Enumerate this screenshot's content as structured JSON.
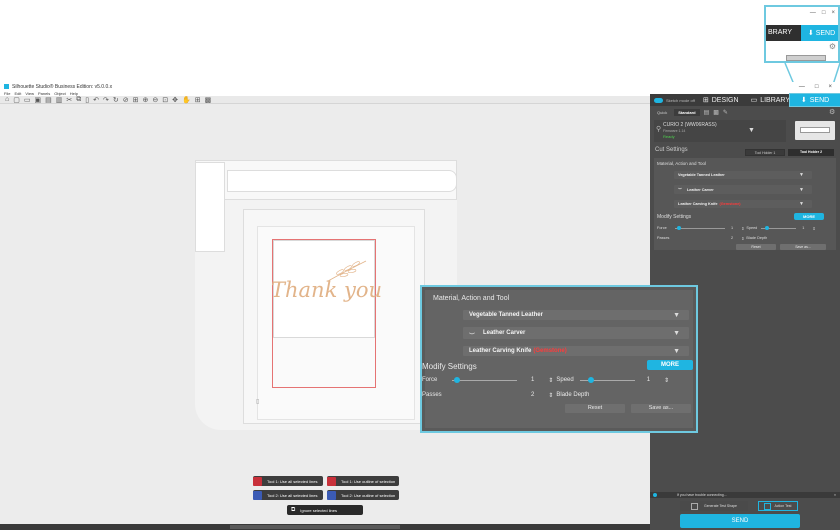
{
  "app": {
    "title": "Silhouette Studio® Business Edition: v5.0.0.x",
    "menu": [
      "File",
      "Edit",
      "View",
      "Panels",
      "Object",
      "Help"
    ],
    "window_controls": [
      "—",
      "□",
      "×"
    ]
  },
  "zoom_top": {
    "window_controls": [
      "—",
      "□",
      "×"
    ],
    "library_label": "BRARY",
    "send_label": "SEND"
  },
  "header": {
    "sketch_mode": "Sketch mode off",
    "tabs": [
      {
        "label": "DESIGN"
      },
      {
        "label": "LIBRARY"
      },
      {
        "label": "SEND",
        "active": true
      }
    ]
  },
  "send_panel": {
    "mode_tabs": [
      "Quick",
      "Standard"
    ],
    "device_name": "CURIO 2 (WW06RASS)",
    "device_sub": "Firmware 1.14",
    "device_status": "Ready",
    "cut_settings_label": "Cut Settings",
    "tool_holders": [
      "Tool Holder 1",
      "Tool Holder 2"
    ],
    "material_section": "Material, Action and Tool",
    "material": "Vegetable Tanned Leather",
    "action": "Leather Carver",
    "tool": "Leather Carving Knife",
    "tool_suffix": "(Gemstone)",
    "modify_label": "Modify Settings",
    "more_label": "MORE",
    "force_label": "Force",
    "force_value": "1",
    "speed_label": "Speed",
    "speed_value": "1",
    "passes_label": "Passes",
    "passes_value": "2",
    "blade_label": "Blade Depth",
    "reset_label": "Reset",
    "save_label": "Save as...",
    "alert_text": "If you have trouble connecting...",
    "test_cut_label": "Generate Test Shape",
    "alt_btn_label": "Action Test",
    "send_button": "SEND"
  },
  "zoom_box": {
    "section": "Material, Action and Tool",
    "material": "Vegetable Tanned Leather",
    "action": "Leather Carver",
    "tool": "Leather Carving Knife",
    "tool_suffix": "(Gemstone)",
    "modify_label": "Modify Settings",
    "more_label": "MORE",
    "force_label": "Force",
    "force_value": "1",
    "speed_label": "Speed",
    "speed_value": "1",
    "passes_label": "Passes",
    "passes_value": "2",
    "blade_label": "Blade Depth",
    "reset_label": "Reset",
    "save_label": "Save as..."
  },
  "design": {
    "text": "Thank you",
    "text_color": "#e2b48a"
  },
  "bottom_bar": {
    "tool1_all": "Tool 1: Use all selected lines",
    "tool1_outline": "Tool 1: Use outline of selection",
    "tool2_all": "Tool 2: Use all selected lines",
    "tool2_outline": "Tool 2: Use outline of selection",
    "ignore": "Ignore selected lines"
  },
  "colors": {
    "accent": "#1fb5e1",
    "panel": "#4c4c4c",
    "callout": "#6ec9e0",
    "tool1": "#c8303a",
    "tool2": "#3b5bb5",
    "warning": "#ff3b3b"
  }
}
